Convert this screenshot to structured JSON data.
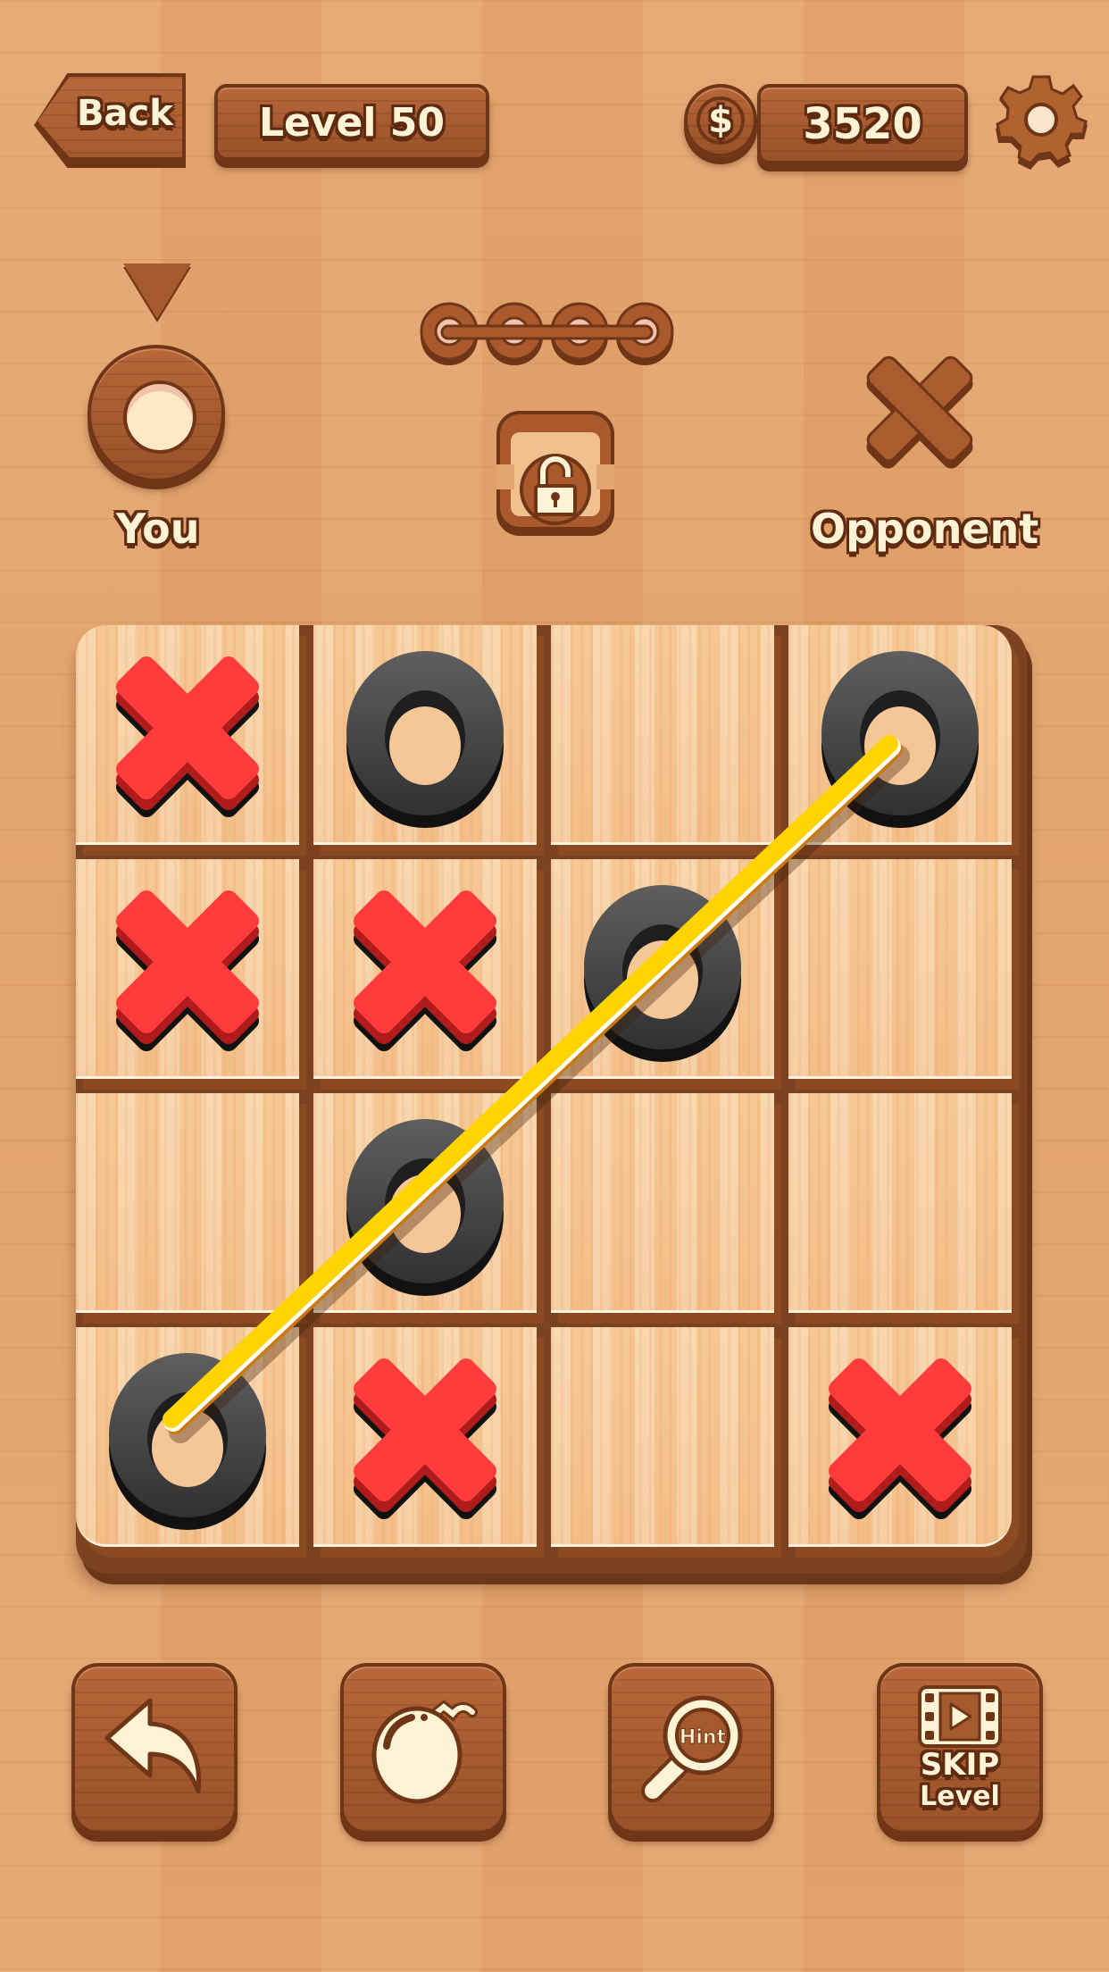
{
  "header": {
    "back_label": "Back",
    "level_label": "Level 50",
    "coins": "3520",
    "coin_icon": "dollar-coin-icon",
    "settings_icon": "gear-icon"
  },
  "players": {
    "you_label": "You",
    "you_symbol": "O",
    "opponent_label": "Opponent",
    "opponent_symbol": "X",
    "current_turn": "You",
    "turn_indicator_icon": "down-triangle-icon"
  },
  "round_progress": {
    "icon": "chain-links-icon",
    "segments": 4
  },
  "lock_button": {
    "icon": "padlock-icon"
  },
  "board": {
    "rows": 4,
    "cols": 4,
    "cells": [
      [
        "X",
        "O",
        "",
        "O"
      ],
      [
        "X",
        "X",
        "O",
        ""
      ],
      [
        "",
        "O",
        "",
        ""
      ],
      [
        "O",
        "X",
        "",
        "X"
      ]
    ],
    "winning_line": {
      "from": [
        3,
        0
      ],
      "to": [
        0,
        3
      ],
      "winner": "O"
    },
    "colors": {
      "x_piece": "#ff3b3b",
      "o_piece": "#3a3a3a",
      "win_line": "#ffd400"
    }
  },
  "toolbar": {
    "undo": {
      "icon": "undo-arrow-icon"
    },
    "bomb": {
      "icon": "bomb-icon"
    },
    "hint": {
      "icon": "magnifier-hint-icon",
      "label": "Hint"
    },
    "skip": {
      "icon": "film-play-icon",
      "label_line1": "SKIP",
      "label_line2": "Level"
    }
  }
}
